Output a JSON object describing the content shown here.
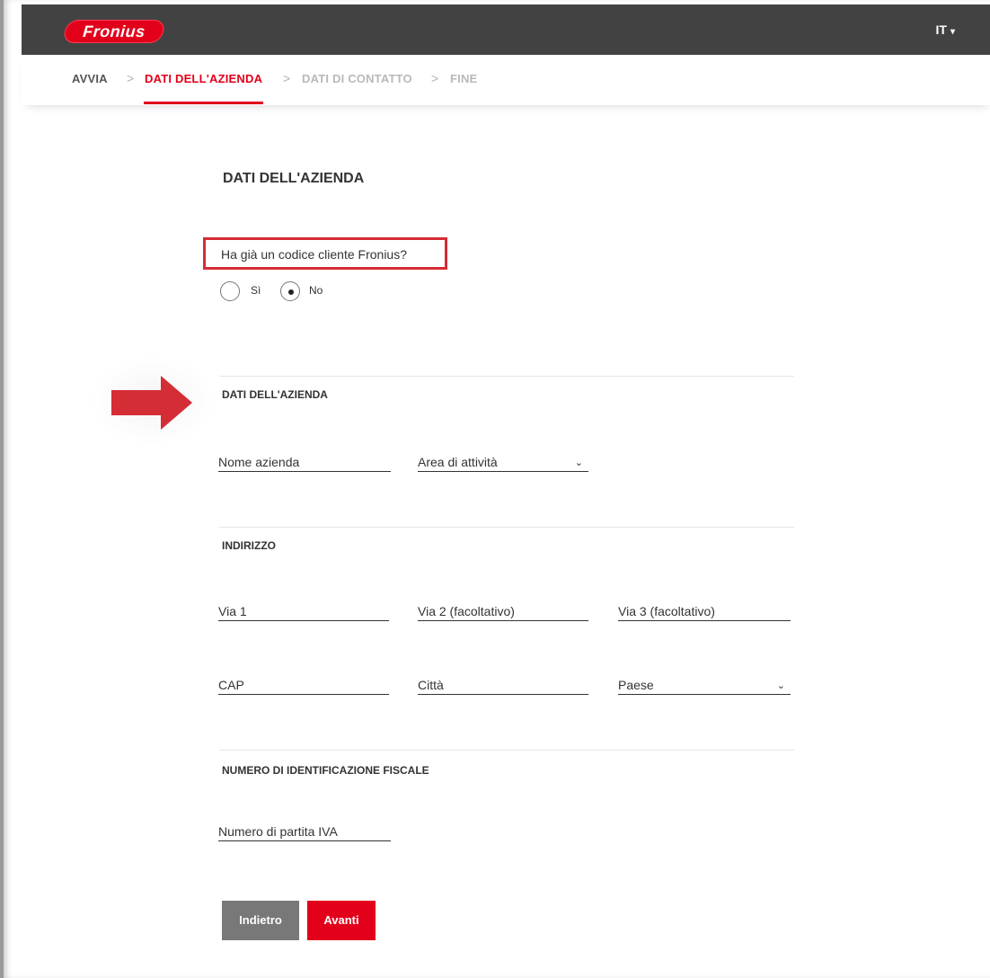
{
  "header": {
    "logo_text": "Fronius",
    "language": "IT",
    "language_caret": "▾"
  },
  "breadcrumb": {
    "steps": [
      "AVVIA",
      "DATI DELL'AZIENDA",
      "DATI DI CONTATTO",
      "FINE"
    ],
    "separator": ">",
    "active_index": 1
  },
  "page": {
    "title": "DATI DELL'AZIENDA",
    "question": "Ha già un codice cliente Fronius?",
    "radio_options": [
      {
        "label": "Sì",
        "checked": false
      },
      {
        "label": "No",
        "checked": true
      }
    ]
  },
  "sections": {
    "company": {
      "title": "DATI DELL'AZIENDA",
      "company_name_placeholder": "Nome azienda",
      "activity_area_placeholder": "Area di attività"
    },
    "address": {
      "title": "INDIRIZZO",
      "street1": "Via 1",
      "street2": "Via 2 (facoltativo)",
      "street3": "Via 3 (facoltativo)",
      "zip": "CAP",
      "city": "Città",
      "country": "Paese"
    },
    "tax": {
      "title": "NUMERO DI IDENTIFICAZIONE FISCALE",
      "vat_placeholder": "Numero di partita IVA"
    }
  },
  "buttons": {
    "back": "Indietro",
    "next": "Avanti"
  },
  "annotations": {
    "highlight_color": "#d42d36",
    "arrow_color": "#d42d36"
  },
  "colors": {
    "brand_red": "#e2001a",
    "topbar": "#424242",
    "back_button": "#787878"
  },
  "icons": {
    "chevron": "chevron-down-icon",
    "arrow": "arrow-right-icon"
  }
}
